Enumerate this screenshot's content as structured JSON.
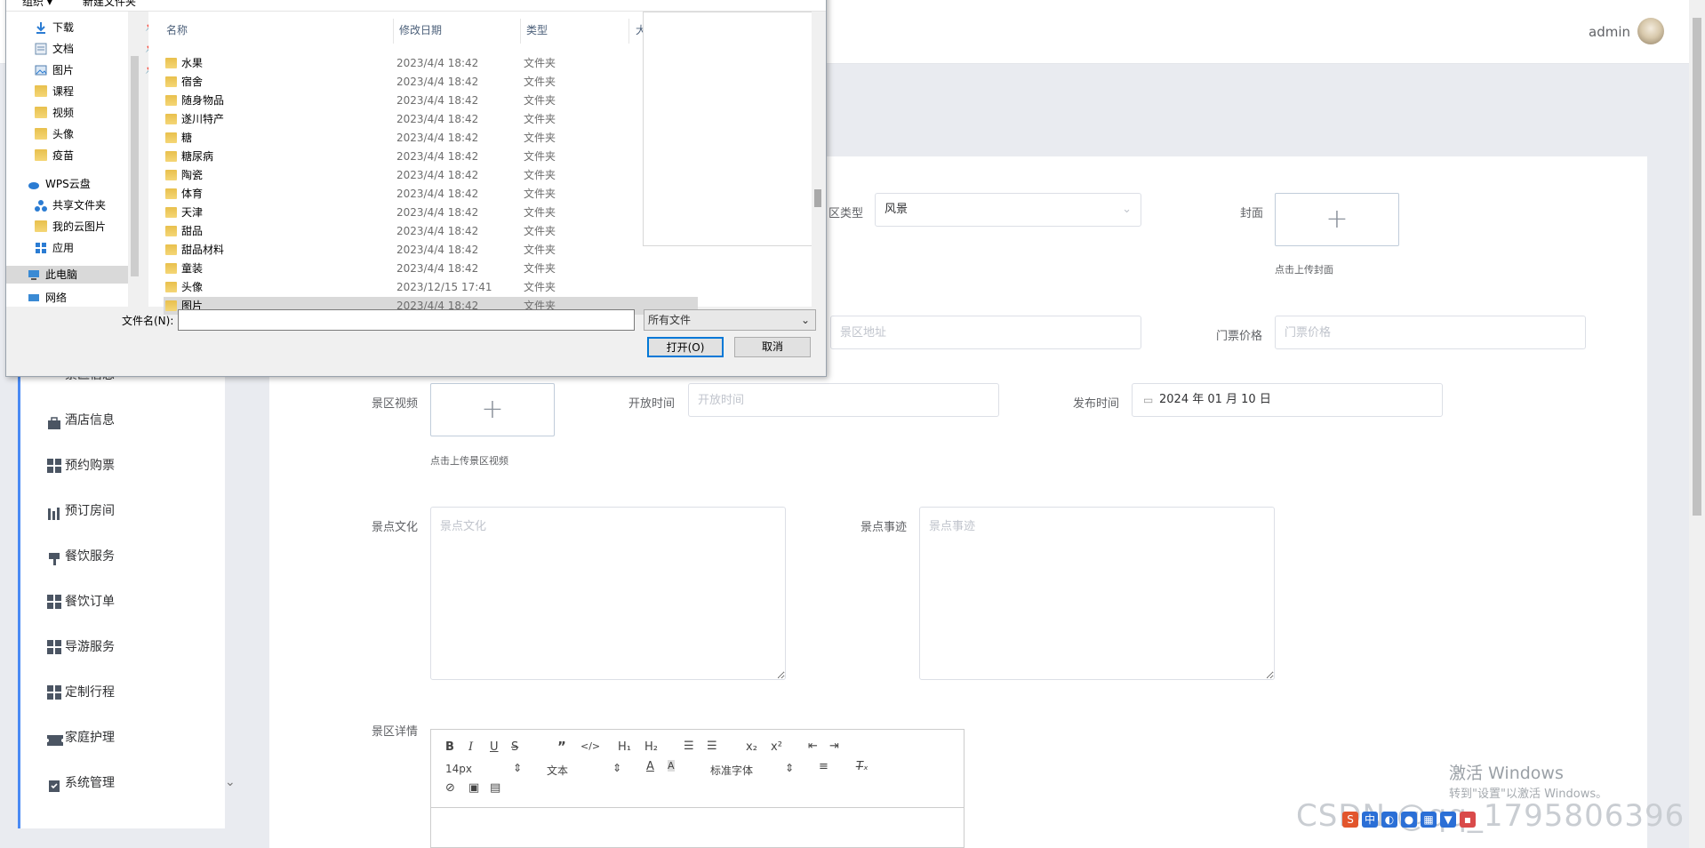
{
  "header": {
    "username": "admin"
  },
  "sidebar": {
    "items": [
      {
        "label": "景区信息"
      },
      {
        "label": "酒店信息"
      },
      {
        "label": "预约购票"
      },
      {
        "label": "预订房间"
      },
      {
        "label": "餐饮服务"
      },
      {
        "label": "餐饮订单"
      },
      {
        "label": "导游服务"
      },
      {
        "label": "定制行程"
      },
      {
        "label": "家庭护理"
      },
      {
        "label": "系统管理"
      }
    ]
  },
  "form": {
    "type_label": "区类型",
    "type_value": "风景",
    "cover_label": "封面",
    "cover_hint": "点击上传封面",
    "address_placeholder": "景区地址",
    "ticket_label": "门票价格",
    "ticket_placeholder": "门票价格",
    "video_label": "景区视频",
    "video_hint": "点击上传景区视频",
    "open_label": "开放时间",
    "open_placeholder": "开放时间",
    "publish_label": "发布时间",
    "publish_value": "2024 年 01 月 10 日",
    "culture_label": "景点文化",
    "culture_placeholder": "景点文化",
    "story_label": "景点事迹",
    "story_placeholder": "景点事迹",
    "detail_label": "景区详情"
  },
  "editor": {
    "font_size": "14px",
    "block_type": "文本",
    "font_family": "标准字体",
    "buttons": {
      "h1": "H₁",
      "h2": "H₂",
      "sub": "x₂",
      "sup": "x²"
    }
  },
  "dialog": {
    "cmd_organize": "组织 ▾",
    "cmd_newfolder": "新建文件夹",
    "tree": [
      {
        "label": "下载",
        "pinned": true
      },
      {
        "label": "文档",
        "pinned": true
      },
      {
        "label": "图片",
        "pinned": true
      },
      {
        "label": "课程"
      },
      {
        "label": "视频"
      },
      {
        "label": "头像"
      },
      {
        "label": "疫苗"
      },
      {
        "label": "WPS云盘"
      },
      {
        "label": "共享文件夹"
      },
      {
        "label": "我的云图片"
      },
      {
        "label": "应用"
      },
      {
        "label": "此电脑"
      },
      {
        "label": "网络"
      }
    ],
    "columns": {
      "name": "名称",
      "date": "修改日期",
      "type": "类型",
      "size": "大"
    },
    "files": [
      {
        "name": "水果",
        "date": "2023/4/4 18:42",
        "type": "文件夹"
      },
      {
        "name": "宿舍",
        "date": "2023/4/4 18:42",
        "type": "文件夹"
      },
      {
        "name": "随身物品",
        "date": "2023/4/4 18:42",
        "type": "文件夹"
      },
      {
        "name": "遂川特产",
        "date": "2023/4/4 18:42",
        "type": "文件夹"
      },
      {
        "name": "糖",
        "date": "2023/4/4 18:42",
        "type": "文件夹"
      },
      {
        "name": "糖尿病",
        "date": "2023/4/4 18:42",
        "type": "文件夹"
      },
      {
        "name": "陶瓷",
        "date": "2023/4/4 18:42",
        "type": "文件夹"
      },
      {
        "name": "体育",
        "date": "2023/4/4 18:42",
        "type": "文件夹"
      },
      {
        "name": "天津",
        "date": "2023/4/4 18:42",
        "type": "文件夹"
      },
      {
        "name": "甜品",
        "date": "2023/4/4 18:42",
        "type": "文件夹"
      },
      {
        "name": "甜品材料",
        "date": "2023/4/4 18:42",
        "type": "文件夹"
      },
      {
        "name": "童装",
        "date": "2023/4/4 18:42",
        "type": "文件夹"
      },
      {
        "name": "头像",
        "date": "2023/12/15 17:41",
        "type": "文件夹"
      },
      {
        "name": "图片",
        "date": "2023/4/4 18:42",
        "type": "文件夹",
        "selected": true
      }
    ],
    "filename_label": "文件名(N):",
    "filename_value": "",
    "filetype_value": "所有文件",
    "open_button": "打开(O)",
    "cancel_button": "取消"
  },
  "watermark": {
    "title": "激活 Windows",
    "subtitle": "转到\"设置\"以激活 Windows。",
    "csdn": "CSDN @qq_1795806396"
  },
  "colors": {
    "accent": "#409eff",
    "sidebar_active": "#4a8af4",
    "folder": "#f0c94f"
  }
}
